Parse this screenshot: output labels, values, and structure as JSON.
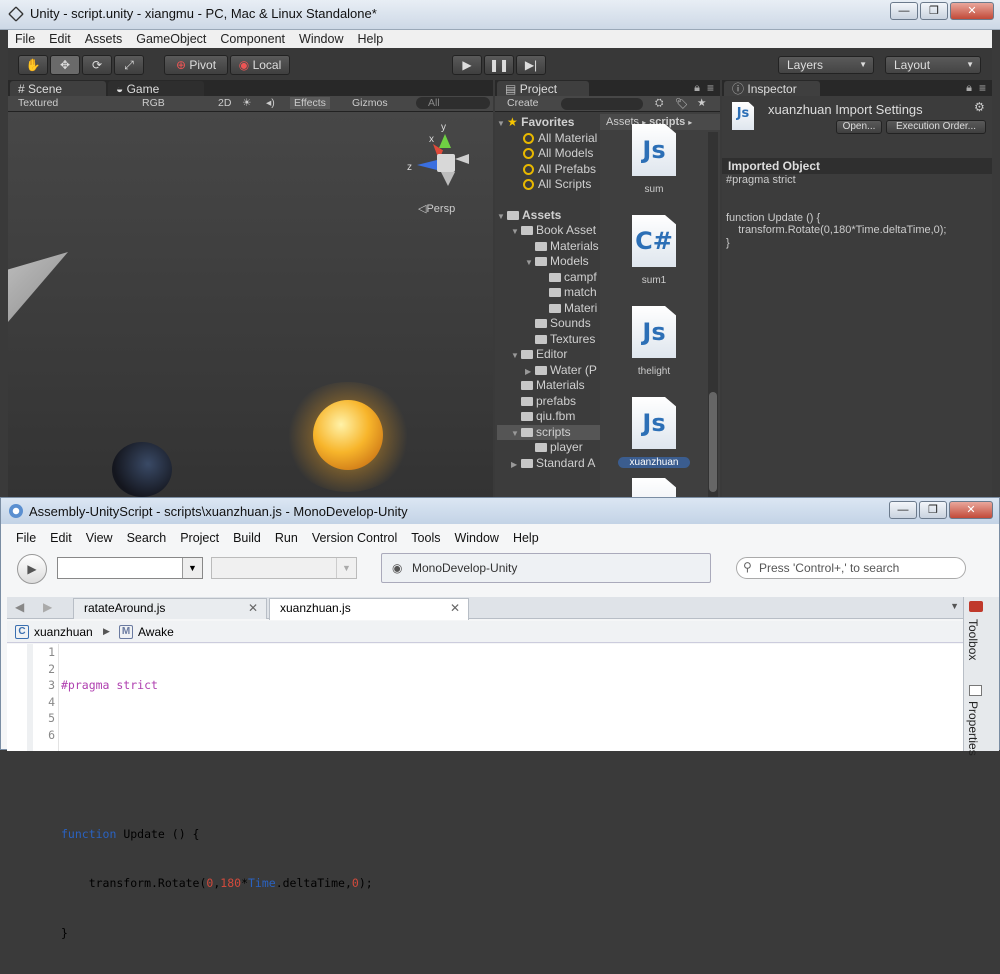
{
  "unity": {
    "title": "Unity - script.unity - xiangmu - PC, Mac & Linux Standalone*",
    "menu": [
      "File",
      "Edit",
      "Assets",
      "GameObject",
      "Component",
      "Window",
      "Help"
    ],
    "toolbar": {
      "pivot": "Pivot",
      "local": "Local",
      "layers": "Layers",
      "layout": "Layout"
    },
    "scene": {
      "tabs": [
        "Scene",
        "Game"
      ],
      "shading": "Textured",
      "render": "RGB",
      "mode2d": "2D",
      "effects": "Effects",
      "gizmos": "Gizmos",
      "search_placeholder": "All",
      "gizmo_x": "x",
      "gizmo_y": "y",
      "gizmo_z": "z",
      "persp": "Persp"
    },
    "project": {
      "tab": "Project",
      "create": "Create",
      "favorites_label": "Favorites",
      "favorites": [
        "All Material",
        "All Models",
        "All Prefabs",
        "All Scripts"
      ],
      "assets_label": "Assets",
      "tree": [
        {
          "label": "Book Asset",
          "indent": 1,
          "open": true
        },
        {
          "label": "Materials",
          "indent": 2,
          "open": false
        },
        {
          "label": "Models",
          "indent": 2,
          "open": true
        },
        {
          "label": "campf",
          "indent": 3,
          "open": false
        },
        {
          "label": "match",
          "indent": 3,
          "open": false
        },
        {
          "label": "Materi",
          "indent": 3,
          "open": false
        },
        {
          "label": "Sounds",
          "indent": 2,
          "open": false
        },
        {
          "label": "Textures",
          "indent": 2,
          "open": false
        },
        {
          "label": "Editor",
          "indent": 1,
          "open": true
        },
        {
          "label": "Water (P",
          "indent": 2,
          "open": false,
          "collapsed": true
        },
        {
          "label": "Materials",
          "indent": 1,
          "open": false
        },
        {
          "label": "prefabs",
          "indent": 1,
          "open": false
        },
        {
          "label": "qiu.fbm",
          "indent": 1,
          "open": false
        },
        {
          "label": "scripts",
          "indent": 1,
          "open": true,
          "selected": true
        },
        {
          "label": "player",
          "indent": 2,
          "open": false
        },
        {
          "label": "Standard A",
          "indent": 1,
          "open": false,
          "collapsed": true
        }
      ],
      "breadcrumb": [
        "Assets",
        "scripts"
      ],
      "files": [
        {
          "name": "sum",
          "type": "Js"
        },
        {
          "name": "sum1",
          "type": "C#"
        },
        {
          "name": "thelight",
          "type": "Js"
        },
        {
          "name": "xuanzhuan",
          "type": "Js",
          "selected": true
        }
      ]
    },
    "inspector": {
      "tab": "Inspector",
      "title": "xuanzhuan Import Settings",
      "open_btn": "Open...",
      "exec_btn": "Execution Order...",
      "section": "Imported Object",
      "code": [
        "#pragma strict",
        "",
        "",
        "function Update () {",
        "    transform.Rotate(0,180*Time.deltaTime,0);",
        "}"
      ]
    }
  },
  "monodevelop": {
    "title": "Assembly-UnityScript - scripts\\xuanzhuan.js - MonoDevelop-Unity",
    "menu": [
      "File",
      "Edit",
      "View",
      "Search",
      "Project",
      "Build",
      "Run",
      "Version Control",
      "Tools",
      "Window",
      "Help"
    ],
    "status": "MonoDevelop-Unity",
    "search_placeholder": "Press 'Control+,' to search",
    "tabs": [
      {
        "label": "ratateAround.js"
      },
      {
        "label": "xuanzhuan.js",
        "active": true
      }
    ],
    "crumb_class": "xuanzhuan",
    "crumb_method": "Awake",
    "side_tabs": [
      "Toolbox",
      "Properties"
    ],
    "lines": [
      "1",
      "2",
      "3",
      "4",
      "5",
      "6"
    ]
  }
}
